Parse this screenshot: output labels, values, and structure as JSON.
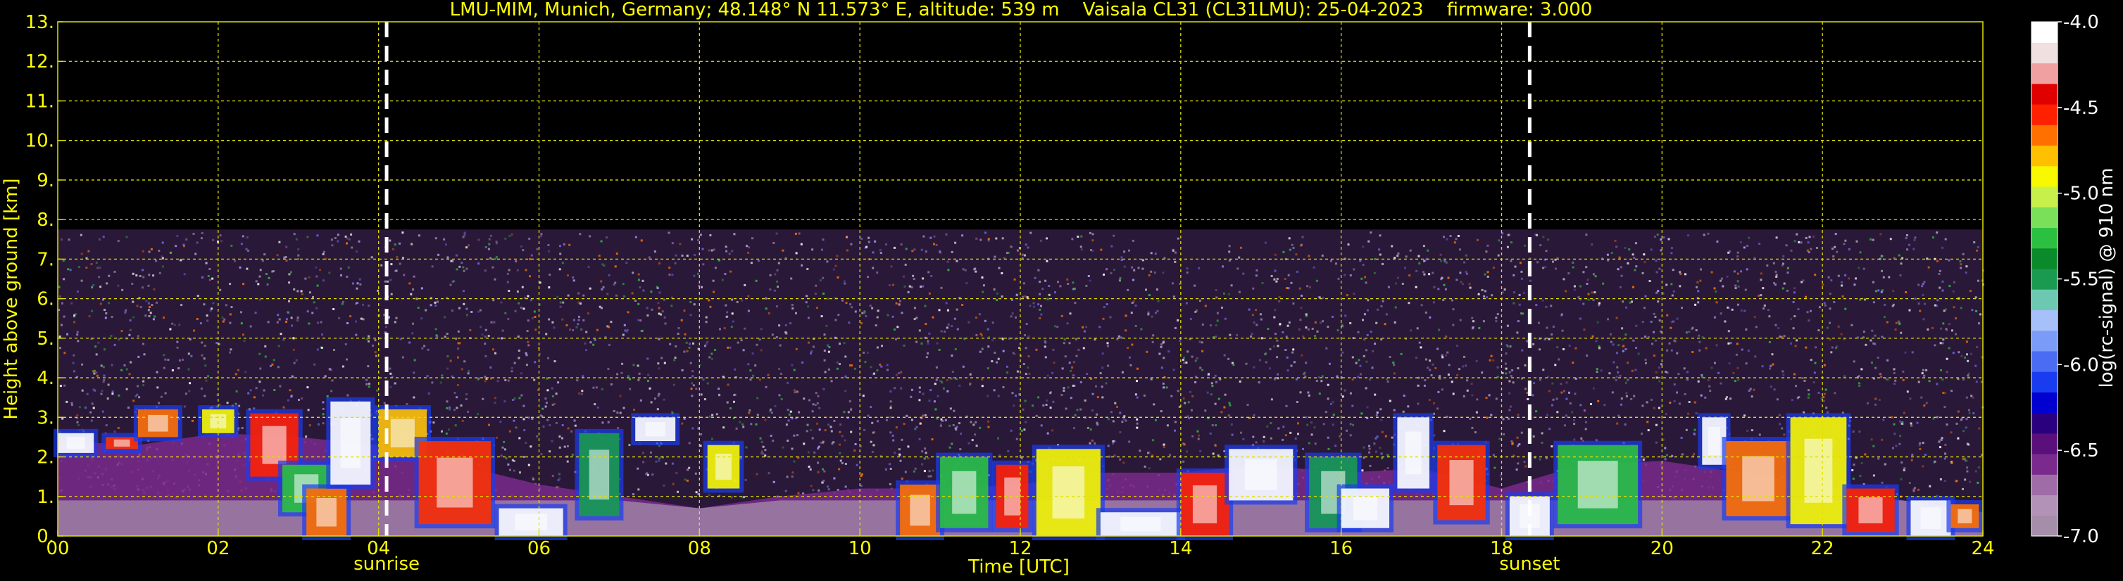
{
  "chart_data": {
    "type": "heatmap",
    "title": "LMU-MIM, Munich, Germany; 48.148° N 11.573° E, altitude: 539 m    Vaisala CL31 (CL31LMU): 25-04-2023    firmware: 3.000",
    "xlabel": "Time [UTC]",
    "ylabel": "Height above ground [km]",
    "xlim": [
      0,
      24
    ],
    "ylim": [
      0,
      13
    ],
    "x_ticks": [
      0,
      2,
      4,
      6,
      8,
      10,
      12,
      14,
      16,
      18,
      20,
      22,
      24
    ],
    "x_tick_labels": [
      "00",
      "02",
      "04",
      "06",
      "08",
      "10",
      "12",
      "14",
      "16",
      "18",
      "20",
      "22",
      "24"
    ],
    "y_ticks": [
      0,
      1,
      2,
      3,
      4,
      5,
      6,
      7,
      8,
      9,
      10,
      11,
      12,
      13
    ],
    "y_tick_labels": [
      "0.",
      "1.",
      "2.",
      "3.",
      "4.",
      "5.",
      "6.",
      "7.",
      "8.",
      "9.",
      "10.",
      "11.",
      "12.",
      "13."
    ],
    "grid": true,
    "markers": [
      {
        "label": "sunrise",
        "x": 4.1
      },
      {
        "label": "sunset",
        "x": 18.35
      }
    ],
    "colorbar": {
      "label": "log(rc-signal) @ 910 nm",
      "range": [
        -7.0,
        -4.0
      ],
      "ticks": [
        -7.0,
        -6.5,
        -6.0,
        -5.5,
        -5.0,
        -4.5,
        -4.0
      ],
      "tick_labels": [
        "-7.0",
        "-6.5",
        "-6.0",
        "-5.5",
        "-5.0",
        "-4.5",
        "-4.0"
      ],
      "colors": [
        "#a58ea9",
        "#b392b8",
        "#9f6ca7",
        "#7a2a8c",
        "#5a0f7a",
        "#2a007e",
        "#0000d0",
        "#1a3cf0",
        "#4a6cf4",
        "#7a9cf8",
        "#a6c0fa",
        "#6cc8b0",
        "#1a9a50",
        "#0a8a2a",
        "#2cc040",
        "#7ae05a",
        "#c8f04a",
        "#f8f800",
        "#ffc000",
        "#ff7000",
        "#ff2000",
        "#e00000",
        "#f0a0a0",
        "#f0e0e0",
        "#ffffff"
      ]
    },
    "signal_top_km": 7.75,
    "aerosol_layer_top_km": [
      [
        0,
        2.4
      ],
      [
        1,
        2.3
      ],
      [
        2,
        2.6
      ],
      [
        3,
        2.5
      ],
      [
        4,
        2.3
      ],
      [
        5,
        1.8
      ],
      [
        6,
        1.3
      ],
      [
        7,
        1.0
      ],
      [
        8,
        0.7
      ],
      [
        9,
        1.0
      ],
      [
        10,
        1.2
      ],
      [
        11,
        1.2
      ],
      [
        12,
        1.3
      ],
      [
        13,
        1.6
      ],
      [
        14,
        1.6
      ],
      [
        15,
        1.8
      ],
      [
        16,
        1.6
      ],
      [
        17,
        1.7
      ],
      [
        18,
        1.2
      ],
      [
        19,
        1.8
      ],
      [
        20,
        1.9
      ],
      [
        21,
        1.6
      ],
      [
        22,
        1.3
      ],
      [
        23,
        0.9
      ],
      [
        24,
        0.6
      ]
    ],
    "cloud_patches": [
      [
        0.0,
        0.45,
        2.1,
        2.6,
        "#ffffff"
      ],
      [
        0.6,
        1.0,
        2.2,
        2.5,
        "#ff3000"
      ],
      [
        1.0,
        1.5,
        2.5,
        3.2,
        "#ff7000"
      ],
      [
        1.8,
        2.2,
        2.6,
        3.2,
        "#f8f800"
      ],
      [
        2.4,
        3.0,
        1.5,
        3.1,
        "#ff2000"
      ],
      [
        2.8,
        3.4,
        0.6,
        1.8,
        "#2cc040"
      ],
      [
        3.1,
        3.6,
        0.0,
        1.2,
        "#ff7000"
      ],
      [
        3.4,
        3.9,
        1.3,
        3.4,
        "#ffffff"
      ],
      [
        4.0,
        4.6,
        2.0,
        3.2,
        "#ffc000"
      ],
      [
        4.5,
        5.4,
        0.3,
        2.4,
        "#ff3000"
      ],
      [
        5.5,
        6.3,
        0.0,
        0.7,
        "#ffffff"
      ],
      [
        6.5,
        7.0,
        0.5,
        2.6,
        "#1a9a50"
      ],
      [
        7.2,
        7.7,
        2.4,
        3.0,
        "#ffffff"
      ],
      [
        8.1,
        8.5,
        1.2,
        2.3,
        "#f8f800"
      ],
      [
        10.5,
        11.0,
        0.0,
        1.3,
        "#ff7000"
      ],
      [
        11.0,
        11.6,
        0.2,
        2.0,
        "#2cc040"
      ],
      [
        11.7,
        12.1,
        0.2,
        1.8,
        "#ff2000"
      ],
      [
        12.2,
        13.0,
        0.0,
        2.2,
        "#f8f800"
      ],
      [
        13.0,
        14.0,
        0.0,
        0.6,
        "#ffffff"
      ],
      [
        14.0,
        14.6,
        0.0,
        1.6,
        "#ff2000"
      ],
      [
        14.6,
        15.4,
        0.9,
        2.2,
        "#ffffff"
      ],
      [
        15.6,
        16.2,
        0.2,
        2.0,
        "#1a9a50"
      ],
      [
        16.0,
        16.6,
        0.2,
        1.2,
        "#ffffff"
      ],
      [
        16.7,
        17.1,
        1.2,
        3.0,
        "#ffffff"
      ],
      [
        17.2,
        17.8,
        0.4,
        2.3,
        "#ff3000"
      ],
      [
        18.1,
        18.6,
        0.0,
        1.0,
        "#ffffff"
      ],
      [
        18.7,
        19.7,
        0.3,
        2.3,
        "#2cc040"
      ],
      [
        20.5,
        20.8,
        1.8,
        3.0,
        "#ffffff"
      ],
      [
        20.8,
        21.6,
        0.5,
        2.4,
        "#ff7000"
      ],
      [
        21.6,
        22.3,
        0.3,
        3.0,
        "#f8f800"
      ],
      [
        22.3,
        22.9,
        0.1,
        1.2,
        "#ff2000"
      ],
      [
        23.1,
        23.6,
        0.0,
        0.9,
        "#ffffff"
      ],
      [
        23.6,
        23.95,
        0.2,
        0.8,
        "#ff7000"
      ]
    ]
  }
}
